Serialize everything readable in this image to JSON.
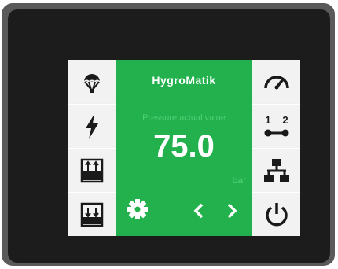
{
  "device": {
    "brand": "HygroMatik",
    "parameter_label": "Pressure actual value",
    "value": "75.0",
    "unit": "bar"
  },
  "left_buttons": [
    {
      "icon": "cloud-parachute-icon"
    },
    {
      "icon": "lightning-icon"
    },
    {
      "icon": "tank-fill-icon"
    },
    {
      "icon": "tank-drain-icon"
    }
  ],
  "right_buttons": [
    {
      "icon": "gauge-icon"
    },
    {
      "icon": "sequence-icon",
      "labels": [
        "1",
        "2"
      ]
    },
    {
      "icon": "network-icon"
    },
    {
      "icon": "power-icon"
    }
  ],
  "colors": {
    "accent": "#22b14c",
    "bezel": "#1c1c1c",
    "icon": "#1a1a1a"
  }
}
